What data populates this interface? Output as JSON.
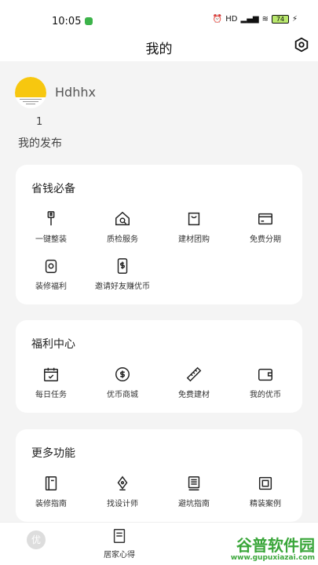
{
  "status_bar": {
    "time": "10:05",
    "network": "HD",
    "battery": "74"
  },
  "nav": {
    "title": "我的"
  },
  "profile": {
    "username": "Hdhhx",
    "post_count": "1",
    "post_label": "我的发布"
  },
  "savings": {
    "title": "省钱必备",
    "items": [
      {
        "label": "一键整装",
        "icon": "paint-roller-icon"
      },
      {
        "label": "质检服务",
        "icon": "house-search-icon"
      },
      {
        "label": "建材团购",
        "icon": "shopping-bag-icon"
      },
      {
        "label": "免费分期",
        "icon": "credit-card-icon"
      },
      {
        "label": "装修福利",
        "icon": "gift-box-icon"
      },
      {
        "label": "邀请好友赚优币",
        "icon": "phone-dollar-icon"
      }
    ]
  },
  "welfare": {
    "title": "福利中心",
    "items": [
      {
        "label": "每日任务",
        "icon": "calendar-check-icon"
      },
      {
        "label": "优币商城",
        "icon": "coin-dollar-icon"
      },
      {
        "label": "免费建材",
        "icon": "ruler-icon"
      },
      {
        "label": "我的优币",
        "icon": "wallet-icon"
      }
    ]
  },
  "more": {
    "title": "更多功能",
    "items": [
      {
        "label": "装修指南",
        "icon": "guide-book-icon"
      },
      {
        "label": "找设计师",
        "icon": "pen-nib-icon"
      },
      {
        "label": "避坑指南",
        "icon": "notebook-icon"
      },
      {
        "label": "精装案例",
        "icon": "album-icon"
      }
    ]
  },
  "tabs": [
    {
      "badge": "优"
    },
    {
      "label": "居家心得",
      "icon": "notes-icon"
    }
  ],
  "watermark": {
    "text": "谷普软件园",
    "url": "www.gupuxiazai.com"
  },
  "colors": {
    "accent": "#f7c70f",
    "status_green": "#3cb34a",
    "watermark": "#3aa63a"
  }
}
